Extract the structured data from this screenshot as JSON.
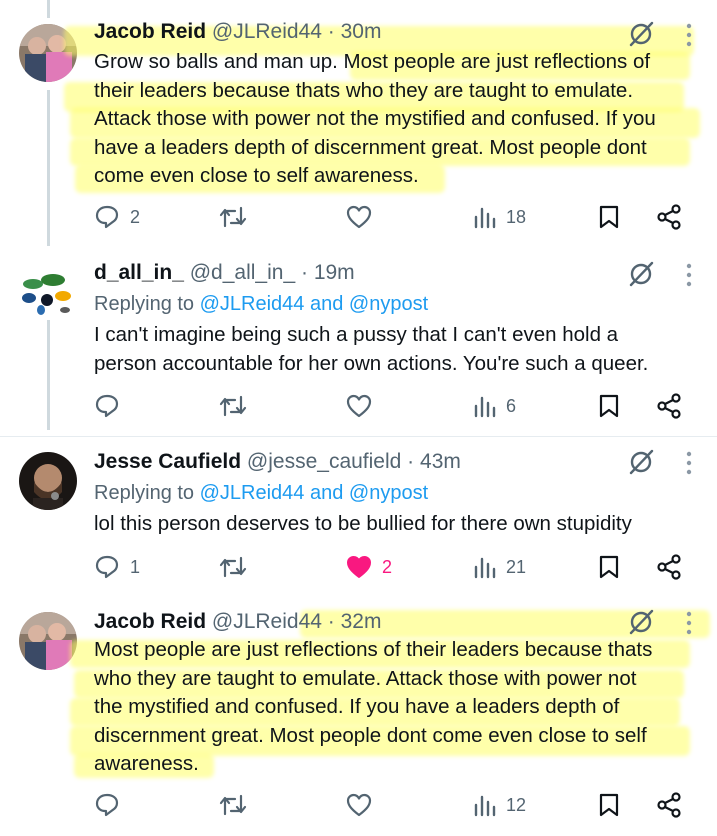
{
  "tweets": [
    {
      "name": "Jacob Reid",
      "handle": "@JLReid44",
      "dot": "·",
      "time": "30m",
      "replying_prefix": "",
      "replying_to": "",
      "text": "Grow so balls and man up. Most people are just reflections of\ntheir leaders because thats who they are taught to emulate.\nAttack those with power not the mystified and confused. If you\nhave a leaders depth of discernment great. Most people dont\ncome even close to self awareness.",
      "replies": "2",
      "reposts": "",
      "likes": "",
      "views": "18"
    },
    {
      "name": "d_all_in_",
      "handle": "@d_all_in_",
      "dot": "·",
      "time": "19m",
      "replying_prefix": "Replying to ",
      "replying_to": "@JLReid44 and @nypost",
      "text": "I can't imagine being such a pussy that I can't even hold a\nperson accountable for her own actions. You're such a queer.",
      "replies": "",
      "reposts": "",
      "likes": "",
      "views": "6"
    },
    {
      "name": "Jesse Caufield",
      "handle": "@jesse_caufield",
      "dot": "·",
      "time": "43m",
      "replying_prefix": "Replying to ",
      "replying_to": "@JLReid44 and @nypost",
      "text": "lol this person deserves to be bullied for there own stupidity",
      "replies": "1",
      "reposts": "",
      "likes": "2",
      "views": "21"
    },
    {
      "name": "Jacob Reid",
      "handle": "@JLReid44",
      "dot": "·",
      "time": "32m",
      "replying_prefix": "",
      "replying_to": "",
      "text": "Most people are just reflections of their leaders because thats\nwho they are taught to emulate. Attack those with power not\nthe mystified and confused. If you have a leaders depth of\ndiscernment great. Most people dont come even close to self\nawareness.",
      "replies": "",
      "reposts": "",
      "likes": "",
      "views": "12"
    }
  ],
  "colors": {
    "link": "#1d9bf0",
    "muted": "#536471",
    "like_active": "#f91880",
    "highlight": "#ffff64"
  },
  "icons": [
    "reply-icon",
    "repost-icon",
    "like-icon",
    "views-icon",
    "bookmark-icon",
    "share-icon",
    "grok-icon",
    "more-icon"
  ]
}
